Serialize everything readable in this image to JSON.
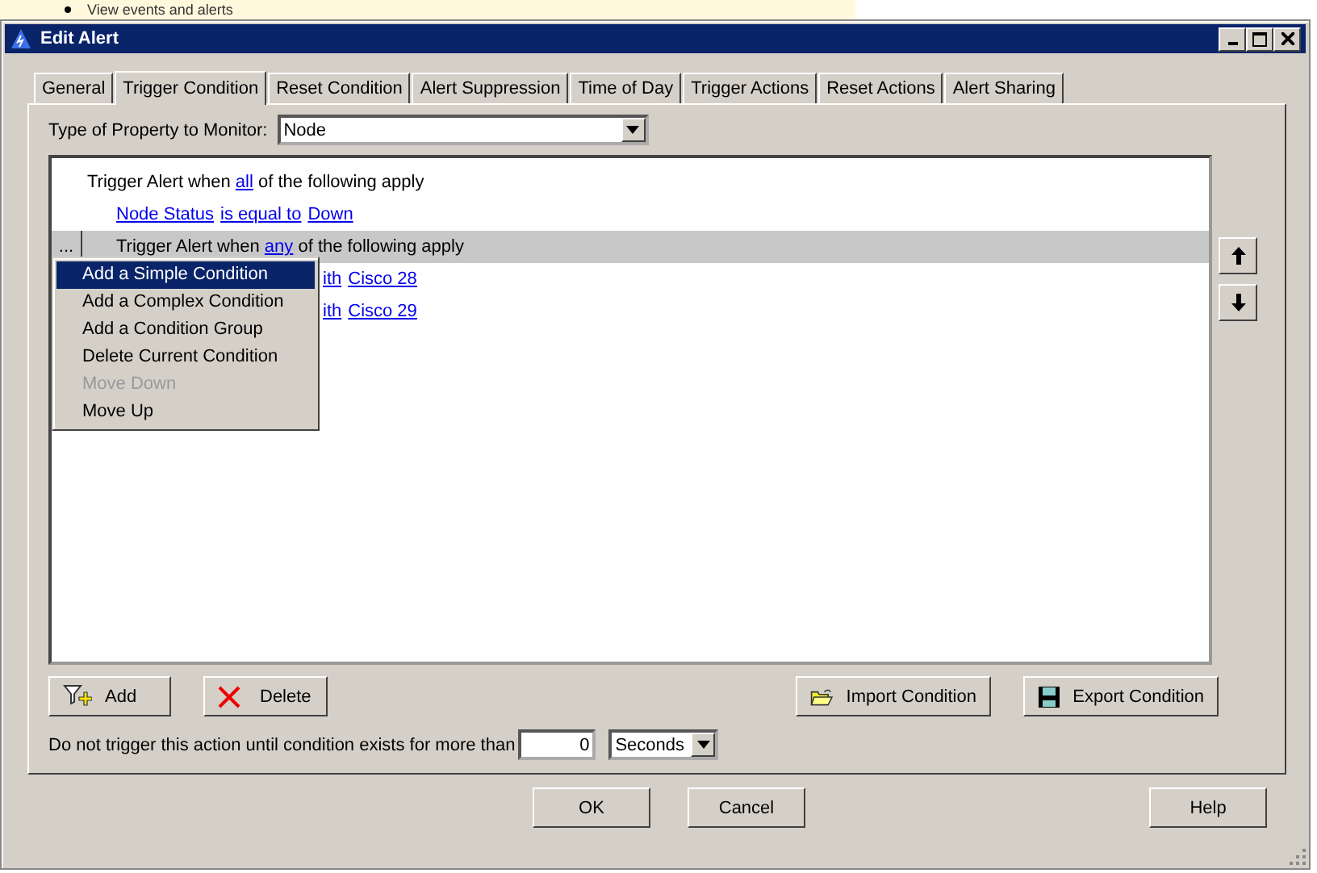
{
  "background": {
    "text": "View events and alerts"
  },
  "window": {
    "title": "Edit Alert"
  },
  "tabs": [
    {
      "label": "General",
      "selected": false
    },
    {
      "label": "Trigger Condition",
      "selected": true
    },
    {
      "label": "Reset Condition",
      "selected": false
    },
    {
      "label": "Alert Suppression",
      "selected": false
    },
    {
      "label": "Time of Day",
      "selected": false
    },
    {
      "label": "Trigger Actions",
      "selected": false
    },
    {
      "label": "Reset Actions",
      "selected": false
    },
    {
      "label": "Alert Sharing",
      "selected": false
    }
  ],
  "property": {
    "label": "Type of Property to Monitor:",
    "value": "Node"
  },
  "tree": {
    "rows": [
      {
        "selected": false,
        "indent": false,
        "parts": [
          {
            "text": "Trigger Alert when ",
            "link": false
          },
          {
            "text": "all",
            "link": true
          },
          {
            "text": " of the following apply",
            "link": false
          }
        ]
      },
      {
        "selected": false,
        "indent": true,
        "parts": [
          {
            "text": "Node Status",
            "link": true
          },
          {
            "text": "is equal to",
            "link": true
          },
          {
            "text": "Down",
            "link": true
          }
        ]
      },
      {
        "selected": true,
        "indent": true,
        "handle": "...",
        "parts": [
          {
            "text": "Trigger Alert when ",
            "link": false
          },
          {
            "text": "any",
            "link": true
          },
          {
            "text": " of the following apply",
            "link": false
          }
        ]
      },
      {
        "selected": false,
        "indent": true,
        "hidden_start": true,
        "parts": [
          {
            "text": "ith",
            "link": true
          },
          {
            "text": "Cisco 28",
            "link": true
          }
        ]
      },
      {
        "selected": false,
        "indent": true,
        "hidden_start": true,
        "parts": [
          {
            "text": "ith",
            "link": true
          },
          {
            "text": "Cisco 29",
            "link": true
          }
        ]
      }
    ]
  },
  "context_menu": [
    {
      "label": "Add a Simple Condition",
      "selected": true,
      "disabled": false
    },
    {
      "label": "Add a Complex Condition",
      "selected": false,
      "disabled": false
    },
    {
      "label": "Add a Condition Group",
      "selected": false,
      "disabled": false
    },
    {
      "label": "Delete Current Condition",
      "selected": false,
      "disabled": false
    },
    {
      "label": "Move Down",
      "selected": false,
      "disabled": true
    },
    {
      "label": "Move Up",
      "selected": false,
      "disabled": false
    }
  ],
  "buttons": [
    {
      "kind": "add",
      "label": "Add"
    },
    {
      "kind": "delete",
      "label": "Delete"
    },
    {
      "kind": "import",
      "label": "Import Condition"
    },
    {
      "kind": "export",
      "label": "Export Condition"
    }
  ],
  "delay": {
    "label": "Do not trigger this action until condition exists for more than",
    "value": "0",
    "unit": "Seconds"
  },
  "footer_buttons": [
    "OK",
    "Cancel",
    "Help"
  ]
}
